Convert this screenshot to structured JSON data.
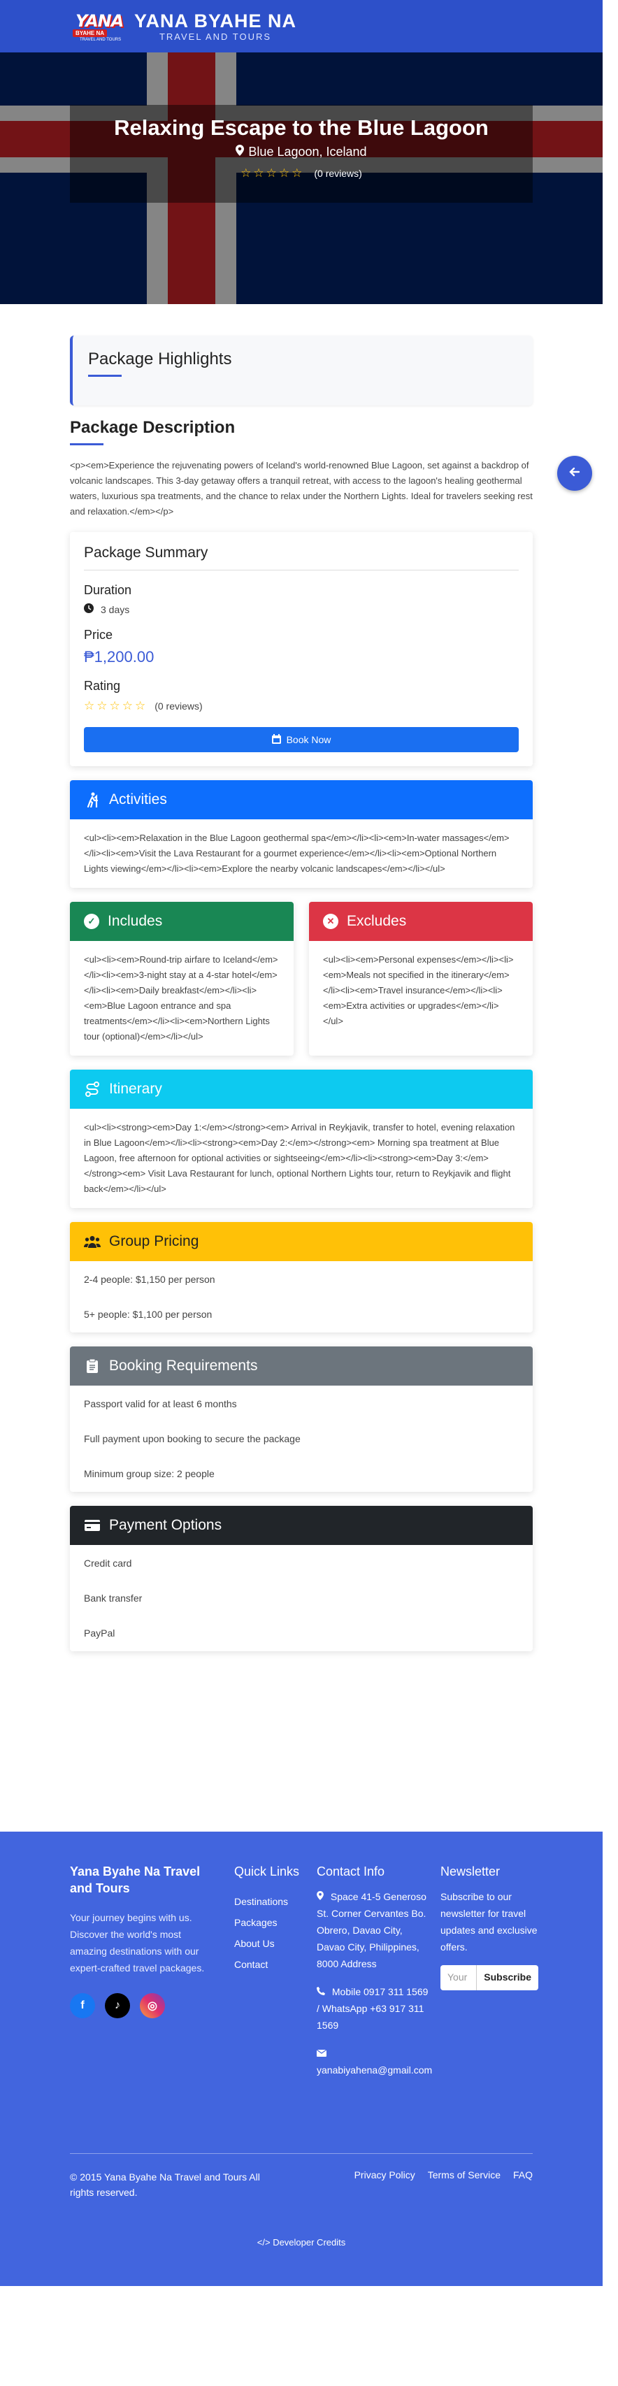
{
  "nav": {
    "logo_main": "YANA",
    "logo_sub": "BYAHE NA",
    "logo_tag": "TRAVEL AND TOURS",
    "title": "YANA BYAHE NA",
    "subtitle": "TRAVEL AND TOURS"
  },
  "hero": {
    "title": "Relaxing Escape to the Blue Lagoon",
    "location": "Blue Lagoon, Iceland",
    "stars": "☆☆☆☆☆",
    "reviews": "(0 reviews)"
  },
  "highlights": {
    "title": "Package Highlights"
  },
  "description": {
    "title": "Package Description",
    "text": "<p><em>Experience the rejuvenating powers of Iceland's world-renowned Blue Lagoon, set against a backdrop of volcanic landscapes. This 3-day getaway offers a tranquil retreat, with access to the lagoon's healing geothermal waters, luxurious spa treatments, and the chance to relax under the Northern Lights. Ideal for travelers seeking rest and relaxation.</em></p>"
  },
  "summary": {
    "title": "Package Summary",
    "duration_label": "Duration",
    "duration": "3 days",
    "price_label": "Price",
    "price": "₱1,200.00",
    "rating_label": "Rating",
    "stars": "☆☆☆☆☆",
    "reviews": "(0 reviews)",
    "book": "Book Now"
  },
  "activities": {
    "title": "Activities",
    "color": "#0d6efd",
    "text": "<ul><li><em>Relaxation in the Blue Lagoon geothermal spa</em></li><li><em>In-water massages</em></li><li><em>Visit the Lava Restaurant for a gourmet experience</em></li><li><em>Optional Northern Lights viewing</em></li><li><em>Explore the nearby volcanic landscapes</em></li></ul>"
  },
  "includes": {
    "title": "Includes",
    "color": "#198754",
    "text": "<ul><li><em>Round-trip airfare to Iceland</em></li><li><em>3-night stay at a 4-star hotel</em></li><li><em>Daily breakfast</em></li><li><em>Blue Lagoon entrance and spa treatments</em></li><li><em>Northern Lights tour (optional)</em></li></ul>"
  },
  "excludes": {
    "title": "Excludes",
    "color": "#dc3545",
    "text": "<ul><li><em>Personal expenses</em></li><li><em>Meals not specified in the itinerary</em></li><li><em>Travel insurance</em></li><li><em>Extra activities or upgrades</em></li></ul>"
  },
  "itinerary": {
    "title": "Itinerary",
    "color": "#0dcaf0",
    "text": "<ul><li><strong><em>Day 1:</em></strong><em> Arrival in Reykjavik, transfer to hotel, evening relaxation in Blue Lagoon</em></li><li><strong><em>Day 2:</em></strong><em> Morning spa treatment at Blue Lagoon, free afternoon for optional activities or sightseeing</em></li><li><strong><em>Day 3:</em></strong><em> Visit Lava Restaurant for lunch, optional Northern Lights tour, return to Reykjavik and flight back</em></li></ul>"
  },
  "group_pricing": {
    "title": "Group Pricing",
    "color": "#ffc107",
    "items": [
      "2-4 people: $1,150 per person",
      "5+ people: $1,100 per person"
    ]
  },
  "requirements": {
    "title": "Booking Requirements",
    "color": "#6c757d",
    "items": [
      "Passport valid for at least 6 months",
      "Full payment upon booking to secure the package",
      "Minimum group size: 2 people"
    ]
  },
  "payment": {
    "title": "Payment Options",
    "color": "#212529",
    "items": [
      "Credit card",
      "Bank transfer",
      "PayPal"
    ]
  },
  "footer": {
    "company": "Yana Byahe Na Travel and Tours",
    "tagline": "Your journey begins with us. Discover the world's most amazing destinations with our expert-crafted travel packages.",
    "quick_title": "Quick Links",
    "links": [
      "Destinations",
      "Packages",
      "About Us",
      "Contact"
    ],
    "contact_title": "Contact Info",
    "address": "Space 41-5 Generoso St. Corner Cervantes Bo. Obrero, Davao City, Davao City, Philippines, 8000 Address",
    "phone": "Mobile 0917 311 1569 / WhatsApp +63 917 311 1569",
    "email": "yanabiyahena@gmail.com",
    "news_title": "Newsletter",
    "news_text": "Subscribe to our newsletter for travel updates and exclusive offers.",
    "news_placeholder": "Your",
    "subscribe": "Subscribe",
    "copyright": "© 2015 Yana Byahe Na Travel and Tours All rights reserved.",
    "privacy": "Privacy Policy",
    "terms": "Terms of Service",
    "faq": "FAQ",
    "credits": "Developer Credits"
  }
}
